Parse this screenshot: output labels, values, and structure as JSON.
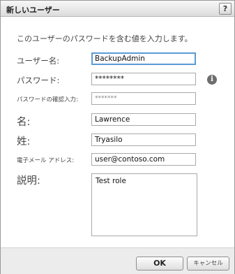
{
  "dialog": {
    "title": "新しいユーザー",
    "help_label": "?",
    "instruction": "このユーザーのパスワードを含む値を入力します。"
  },
  "form": {
    "username": {
      "label": "ユーザー名:",
      "value": "BackupAdmin"
    },
    "password": {
      "label": "パスワード:",
      "value": "********"
    },
    "password_confirm": {
      "label": "パスワードの確認入力:",
      "value": "*******"
    },
    "first_name": {
      "label": "名:",
      "value": "Lawrence"
    },
    "last_name": {
      "label": "姓:",
      "value": "Tryasilo"
    },
    "email": {
      "label": "電子メール アドレス:",
      "value": "user@contoso.com"
    },
    "description": {
      "label": "説明:",
      "value": "Test role"
    }
  },
  "icons": {
    "info": "info-icon",
    "info_glyph": "i"
  },
  "buttons": {
    "ok": "OK",
    "cancel": "キャンセル"
  }
}
